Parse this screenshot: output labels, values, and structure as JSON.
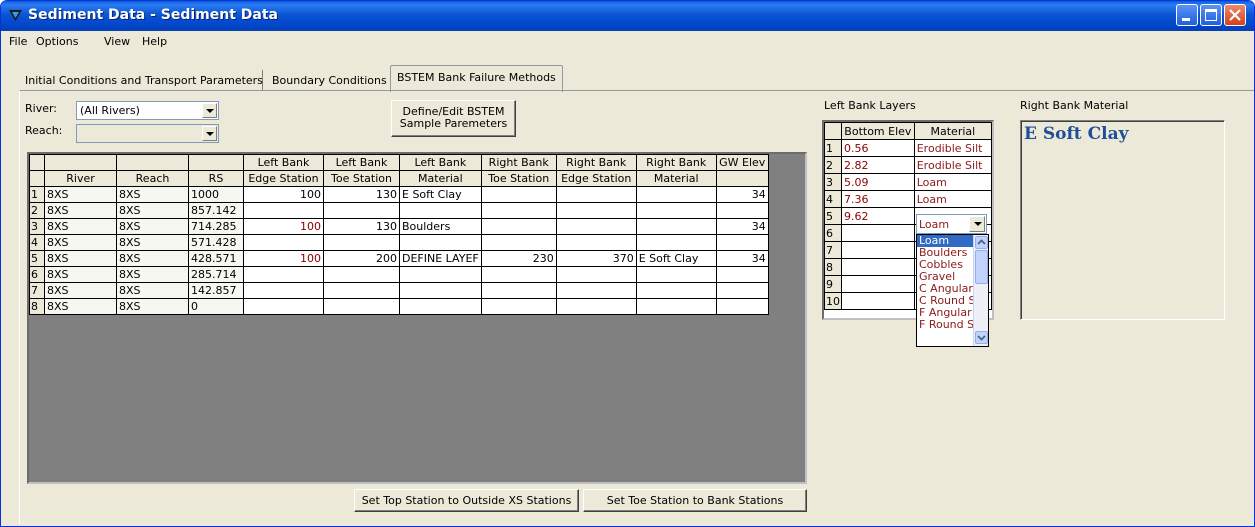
{
  "window": {
    "title": "Sediment Data - Sediment Data"
  },
  "menu": [
    "File",
    "Options",
    "View",
    "Help"
  ],
  "tabs": [
    "Initial Conditions and Transport Parameters",
    "Boundary Conditions",
    "BSTEM Bank Failure Methods"
  ],
  "river": {
    "label": "River:",
    "value": "(All Rivers)"
  },
  "reach": {
    "label": "Reach:",
    "value": ""
  },
  "define_button": {
    "line1": "Define/Edit BSTEM",
    "line2": "Sample Paremeters"
  },
  "main_table": {
    "header1": [
      "",
      "",
      "",
      "Left Bank",
      "Left Bank",
      "Left Bank",
      "Right Bank",
      "Right Bank",
      "Right Bank",
      "GW Elev"
    ],
    "header2": [
      "River",
      "Reach",
      "RS",
      "Edge Station",
      "Toe Station",
      "Material",
      "Toe Station",
      "Edge Station",
      "Material",
      ""
    ],
    "rows": [
      [
        "1",
        "8XS",
        "8XS",
        "1000",
        "100",
        "130",
        "E Soft Clay",
        "",
        "",
        "",
        "34"
      ],
      [
        "2",
        "8XS",
        "8XS",
        "857.142",
        "",
        "",
        "",
        "",
        "",
        "",
        ""
      ],
      [
        "3",
        "8XS",
        "8XS",
        "714.285",
        "100",
        "130",
        "Boulders",
        "",
        "",
        "",
        "34"
      ],
      [
        "4",
        "8XS",
        "8XS",
        "571.428",
        "",
        "",
        "",
        "",
        "",
        "",
        ""
      ],
      [
        "5",
        "8XS",
        "8XS",
        "428.571",
        "100",
        "200",
        "DEFINE LAYEF",
        "230",
        "370",
        "E Soft Clay",
        "34"
      ],
      [
        "6",
        "8XS",
        "8XS",
        "285.714",
        "",
        "",
        "",
        "",
        "",
        "",
        ""
      ],
      [
        "7",
        "8XS",
        "8XS",
        "142.857",
        "",
        "",
        "",
        "",
        "",
        "",
        ""
      ],
      [
        "8",
        "8XS",
        "8XS",
        "0",
        "",
        "",
        "",
        "",
        "",
        "",
        ""
      ]
    ]
  },
  "bottom_buttons": {
    "top_station": "Set Top Station to Outside XS Stations",
    "toe_station": "Set Toe Station to Bank Stations"
  },
  "left_bank_layers": {
    "label": "Left Bank Layers",
    "headers": [
      "Bottom Elev",
      "Material"
    ],
    "rows": [
      [
        "1",
        "0.56",
        "Erodible Silt"
      ],
      [
        "2",
        "2.82",
        "Erodible Silt"
      ],
      [
        "3",
        "5.09",
        "Loam"
      ],
      [
        "4",
        "7.36",
        "Loam"
      ],
      [
        "5",
        "9.62",
        ""
      ],
      [
        "6",
        "",
        ""
      ],
      [
        "7",
        "",
        ""
      ],
      [
        "8",
        "",
        ""
      ],
      [
        "9",
        "",
        ""
      ],
      [
        "10",
        "",
        ""
      ]
    ],
    "edit_value": "Loam",
    "dropdown_options": [
      "Loam",
      "Boulders",
      "Cobbles",
      "Gravel",
      "C Angular",
      "C Round S",
      "F Angular",
      "F Round S"
    ],
    "selected_option": "Loam"
  },
  "right_bank_material": {
    "label": "Right Bank Material",
    "value": "E Soft Clay"
  }
}
